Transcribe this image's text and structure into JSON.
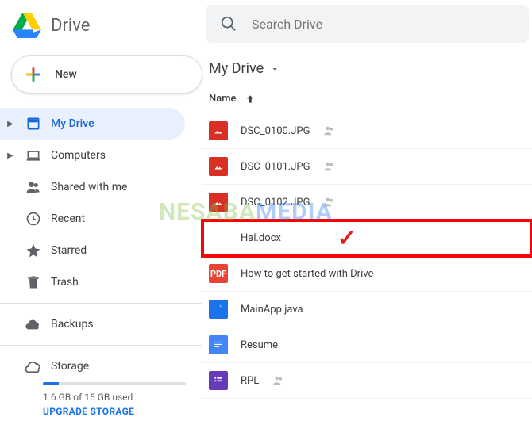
{
  "app_name": "Drive",
  "new_button_label": "New",
  "search": {
    "placeholder": "Search Drive"
  },
  "sidebar": {
    "items": [
      {
        "label": "My Drive",
        "expandable": true,
        "active": true
      },
      {
        "label": "Computers",
        "expandable": true,
        "active": false
      },
      {
        "label": "Shared with me",
        "expandable": false,
        "active": false
      },
      {
        "label": "Recent",
        "expandable": false,
        "active": false
      },
      {
        "label": "Starred",
        "expandable": false,
        "active": false
      },
      {
        "label": "Trash",
        "expandable": false,
        "active": false
      }
    ],
    "backups_label": "Backups",
    "storage": {
      "title": "Storage",
      "used_text": "1.6 GB of 15 GB used",
      "upgrade_label": "UPGRADE STORAGE",
      "percent": 11
    }
  },
  "main": {
    "breadcrumb_title": "My Drive",
    "column_header": "Name",
    "files": [
      {
        "name": "DSC_0100.JPG",
        "type": "image",
        "shared": true
      },
      {
        "name": "DSC_0101.JPG",
        "type": "image",
        "shared": true
      },
      {
        "name": "DSC_0102.JPG",
        "type": "image",
        "shared": true
      },
      {
        "name": "Hal.docx",
        "type": "word",
        "shared": false,
        "highlighted": true
      },
      {
        "name": "How to get started with Drive",
        "type": "pdf",
        "shared": false
      },
      {
        "name": "MainApp.java",
        "type": "code",
        "shared": false
      },
      {
        "name": "Resume",
        "type": "doc",
        "shared": false
      },
      {
        "name": "RPL",
        "type": "form",
        "shared": true
      }
    ]
  },
  "watermark": {
    "part1": "NESABA",
    "part2": "MEDIA"
  }
}
